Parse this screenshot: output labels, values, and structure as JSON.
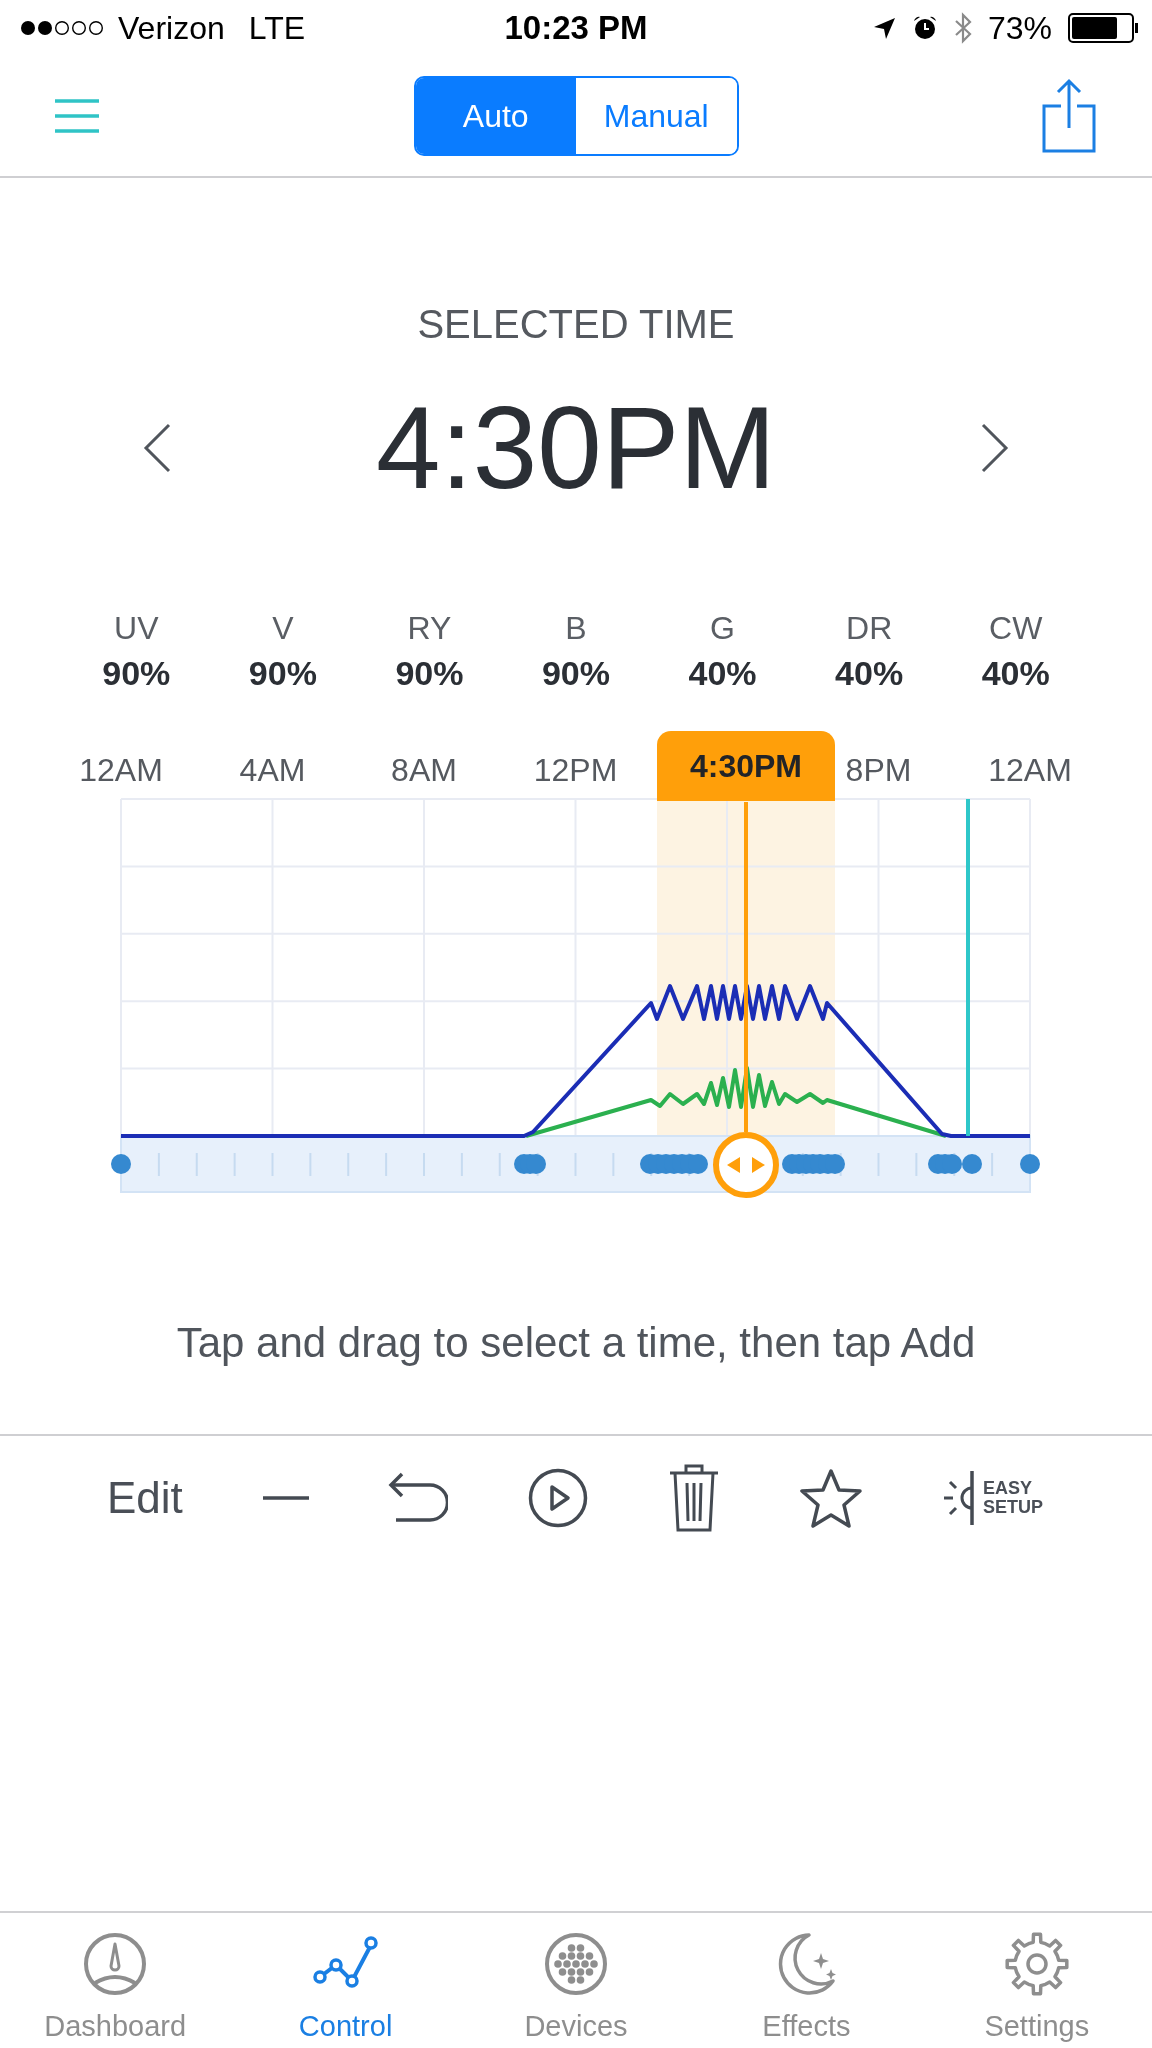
{
  "status_bar": {
    "carrier": "Verizon",
    "network": "LTE",
    "time": "10:23 PM",
    "battery": "73%"
  },
  "header": {
    "modes": [
      {
        "label": "Auto",
        "selected": true
      },
      {
        "label": "Manual",
        "selected": false
      }
    ]
  },
  "selected_time": {
    "title": "SELECTED TIME",
    "value": "4:30PM"
  },
  "channels": [
    {
      "name": "UV",
      "value": "90%"
    },
    {
      "name": "V",
      "value": "90%"
    },
    {
      "name": "RY",
      "value": "90%"
    },
    {
      "name": "B",
      "value": "90%"
    },
    {
      "name": "G",
      "value": "40%"
    },
    {
      "name": "DR",
      "value": "40%"
    },
    {
      "name": "CW",
      "value": "40%"
    }
  ],
  "timeline": {
    "hour_labels": [
      "12AM",
      "4AM",
      "8AM",
      "12PM",
      "8PM",
      "12AM"
    ],
    "marker_label": "4:30PM"
  },
  "hint": "Tap and drag to select a time, then tap Add",
  "toolbar": {
    "edit": "Edit",
    "easy_setup": "EASY SETUP"
  },
  "tabs": [
    {
      "label": "Dashboard",
      "selected": false
    },
    {
      "label": "Control",
      "selected": true
    },
    {
      "label": "Devices",
      "selected": false
    },
    {
      "label": "Effects",
      "selected": false
    },
    {
      "label": "Settings",
      "selected": false
    }
  ]
}
